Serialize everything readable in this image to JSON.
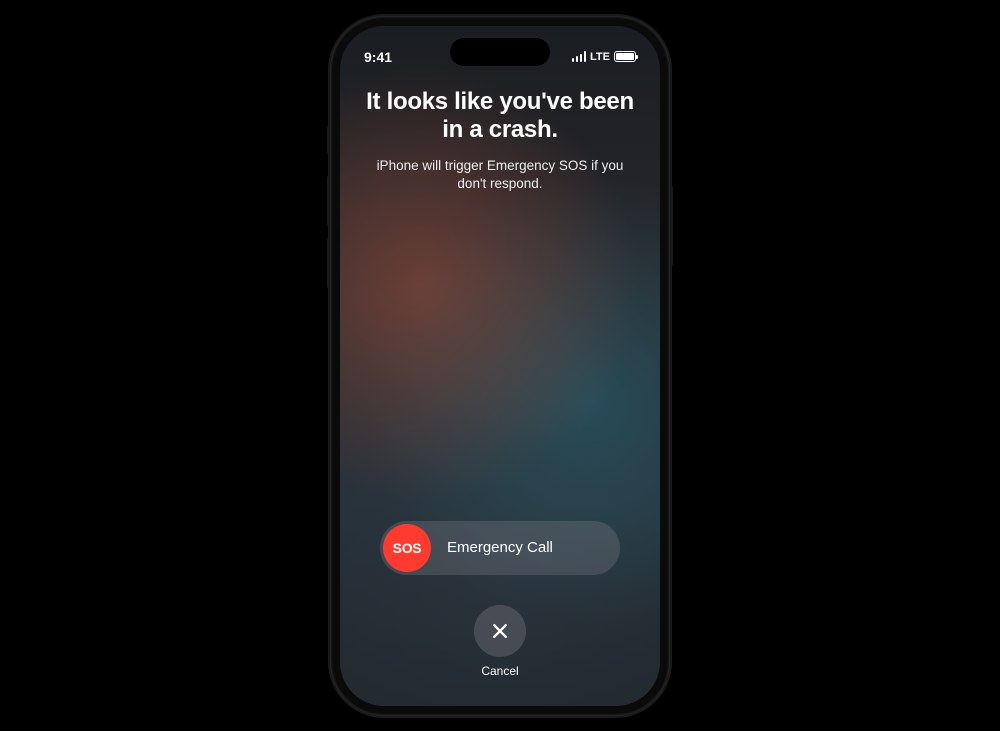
{
  "status_bar": {
    "time": "9:41",
    "network": "LTE"
  },
  "crash_screen": {
    "heading": "It looks like you've been in a crash.",
    "subtitle": "iPhone will trigger Emergency SOS if you don't respond.",
    "sos_knob_label": "SOS",
    "slider_label": "Emergency Call",
    "cancel_label": "Cancel"
  }
}
